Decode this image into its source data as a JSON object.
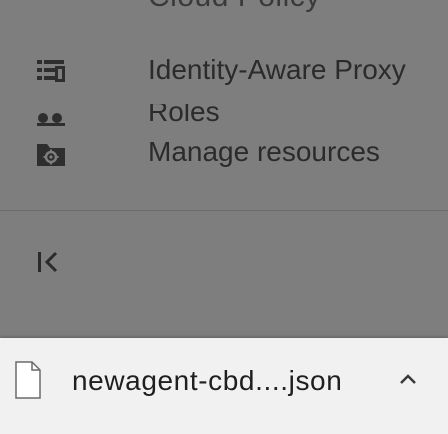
{
  "sidebar": {
    "partial_top_label": "Cloud Policy Troubleshooter",
    "items": [
      {
        "label": "Identity-Aware Proxy",
        "icon": "identity-aware-proxy-icon"
      },
      {
        "label": "Roles",
        "icon": "roles-icon"
      },
      {
        "label": "Manage resources",
        "icon": "manage-resources-icon"
      }
    ],
    "collapse_icon": "collapse-sidebar-icon"
  },
  "download_bar": {
    "file_name": "newagent-cbd....json",
    "file_icon": "file-icon",
    "menu_icon": "chevron-up-icon"
  },
  "colors": {
    "overlay": "#7e7e7e",
    "download_bar_bg": "#f1f1f1",
    "text": "#2b2b2b"
  }
}
